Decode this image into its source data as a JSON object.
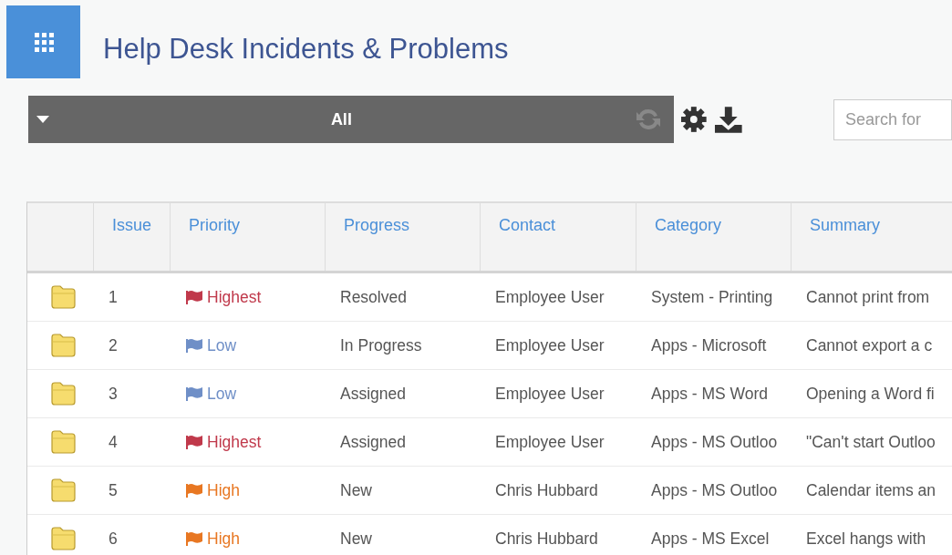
{
  "title": "Help Desk Incidents & Problems",
  "view_selector": {
    "label": "All"
  },
  "search": {
    "placeholder": "Search for"
  },
  "table": {
    "columns": [
      "Issue",
      "Priority",
      "Progress",
      "Contact",
      "Category",
      "Summary"
    ],
    "rows": [
      {
        "issue": "1",
        "priority": {
          "label": "Highest",
          "color": "#c0394b"
        },
        "progress": "Resolved",
        "contact": "Employee User",
        "category": "System - Printing",
        "summary": "Cannot print from"
      },
      {
        "issue": "2",
        "priority": {
          "label": "Low",
          "color": "#6f8fc7"
        },
        "progress": "In Progress",
        "contact": "Employee User",
        "category": "Apps - Microsoft",
        "summary": "Cannot export a c"
      },
      {
        "issue": "3",
        "priority": {
          "label": "Low",
          "color": "#6f8fc7"
        },
        "progress": "Assigned",
        "contact": "Employee User",
        "category": "Apps - MS Word",
        "summary": "Opening a Word fi"
      },
      {
        "issue": "4",
        "priority": {
          "label": "Highest",
          "color": "#c0394b"
        },
        "progress": "Assigned",
        "contact": "Employee User",
        "category": "Apps - MS Outloo",
        "summary": "\"Can't start Outloo"
      },
      {
        "issue": "5",
        "priority": {
          "label": "High",
          "color": "#e87722"
        },
        "progress": "New",
        "contact": "Chris Hubbard",
        "category": "Apps - MS Outloo",
        "summary": "Calendar items an"
      },
      {
        "issue": "6",
        "priority": {
          "label": "High",
          "color": "#e87722"
        },
        "progress": "New",
        "contact": "Chris Hubbard",
        "category": "Apps - MS Excel",
        "summary": "Excel hangs with"
      }
    ]
  }
}
